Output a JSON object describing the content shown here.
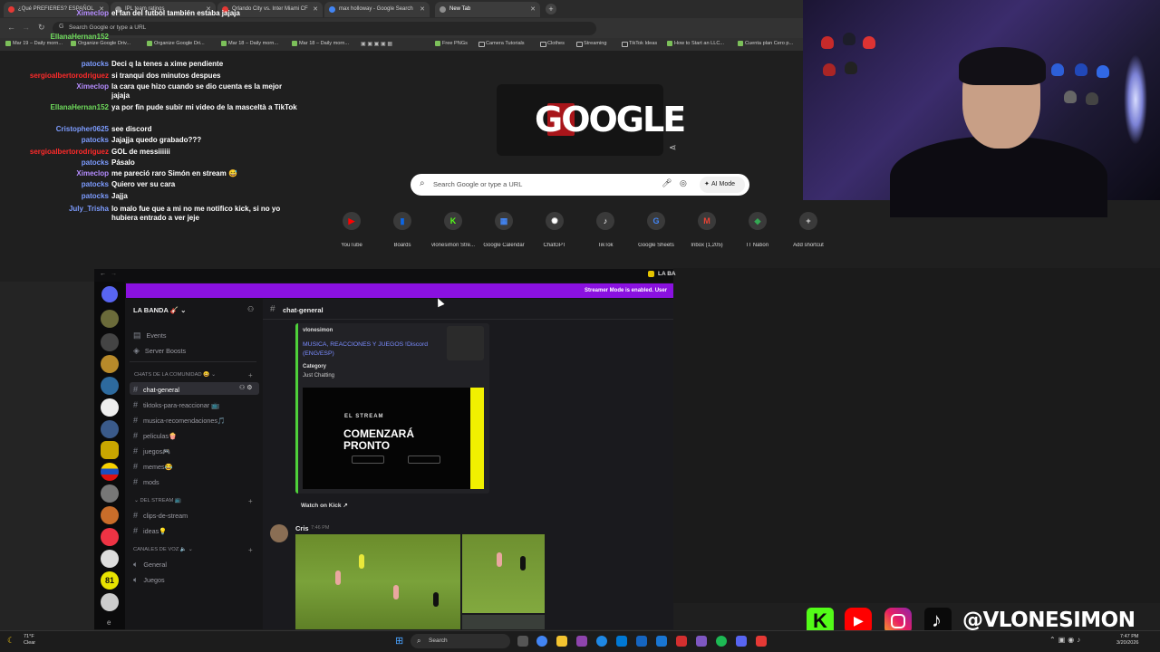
{
  "browser": {
    "tabs": [
      {
        "label": "¿Qué PREFIERES? ESPAÑOL",
        "color": "#e53935"
      },
      {
        "label": "IPL team ratings",
        "color": "#8e8e8e"
      },
      {
        "label": "Orlando City vs. Inter Miami CF",
        "color": "#e53935"
      },
      {
        "label": "max holloway - Google Search",
        "color": "#4285f4"
      },
      {
        "label": "New Tab",
        "color": "#8e8e8e"
      }
    ],
    "omnibox_placeholder": "Search Google or type a URL",
    "bookmarks": [
      "Mar 19 – Daily morn...",
      "Organize Google Driv...",
      "Organize Google Dri...",
      "Mar 18 – Daily morn...",
      "Mar 18 – Daily morn...",
      "Free PNGs",
      "Camera Tutorials",
      "Clothes",
      "Streaming",
      "TikTok Ideas",
      "How to Start an LLC...",
      "Cuenta plan Cero p..."
    ]
  },
  "ntp": {
    "doodle_text": "GOOGLE",
    "search_placeholder": "Search Google or type a URL",
    "ai_mode_label": "AI Mode",
    "shortcuts": [
      {
        "label": "YouTube",
        "glyph": "▶",
        "color": "#ff0000"
      },
      {
        "label": "Boards",
        "glyph": "▮",
        "color": "#0c66e4"
      },
      {
        "label": "vlonesimon Stre...",
        "glyph": "K",
        "color": "#53fc18"
      },
      {
        "label": "Google Calendar",
        "glyph": "▦",
        "color": "#4285f4"
      },
      {
        "label": "ChatGPT",
        "glyph": "✺",
        "color": "#ffffff"
      },
      {
        "label": "TikTok",
        "glyph": "♪",
        "color": "#ffffff"
      },
      {
        "label": "Google Sheets",
        "glyph": "G",
        "color": "#4285f4"
      },
      {
        "label": "Inbox (1,205)",
        "glyph": "M",
        "color": "#ea4335"
      },
      {
        "label": "IT Nation",
        "glyph": "◆",
        "color": "#34a853"
      },
      {
        "label": "Add shortcut",
        "glyph": "+",
        "color": "#dddddd"
      }
    ]
  },
  "chat": [
    {
      "user": "Ximeclop",
      "user_color": "#b58cff",
      "text": "el fan del futbol también estaba jajaja"
    },
    {
      "user": "EllanaHernan152",
      "user_color": "#6fdc5c",
      "text": ""
    },
    {
      "user": "patocks",
      "user_color": "#7d9cff",
      "text": "Deci q la tenes a xime pendiente"
    },
    {
      "user": "sergioalbertorodriguez",
      "user_color": "#ff2a2a",
      "text": "si tranqui dos minutos despues"
    },
    {
      "user": "Ximeclop",
      "user_color": "#b58cff",
      "text": "la cara que hizo cuando se dio cuenta es la mejor jajaja"
    },
    {
      "user": "EllanaHernan152",
      "user_color": "#6fdc5c",
      "text": "ya por fin pude subir mi video de la masceltà a TikTok"
    },
    {
      "user": "Cristopher0625",
      "user_color": "#7d9cff",
      "text": "see discord"
    },
    {
      "user": "patocks",
      "user_color": "#7d9cff",
      "text": "Jajajja quedo grabado???"
    },
    {
      "user": "sergioalbertorodriguez",
      "user_color": "#ff2a2a",
      "text": "GOL de messiiiiii"
    },
    {
      "user": "patocks",
      "user_color": "#7d9cff",
      "text": "Pásalo"
    },
    {
      "user": "Ximeclop",
      "user_color": "#b58cff",
      "text": "me pareció raro Simón en stream 😅"
    },
    {
      "user": "patocks",
      "user_color": "#7d9cff",
      "text": "Quiero ver su cara"
    },
    {
      "user": "patocks",
      "user_color": "#7d9cff",
      "text": "Jajja"
    },
    {
      "user": "July_Trisha",
      "user_color": "#7d9cff",
      "text": "lo malo fue que a mi no me notifico kick, si no yo hubiera entrado a ver jeje"
    }
  ],
  "discord": {
    "banner": "Streamer Mode is enabled. User",
    "topbar_right": "LA BA",
    "server_name": "LA BANDA 🎸",
    "channel_header": "chat-general",
    "nav": [
      "Events",
      "Server Boosts"
    ],
    "categories": {
      "community": "CHATS DE LA COMUNIDAD 😀",
      "stream": "DEL STREAM 📺",
      "voice": "CANALES DE VOZ 🔈"
    },
    "text_channels": [
      "chat-general",
      "tiktoks-para-reaccionar 📺",
      "musica-recomendaciones🎵",
      "peliculas🍿",
      "juegos🎮",
      "memes😂",
      "mods"
    ],
    "stream_channels": [
      "clips-de-stream",
      "ideas💡"
    ],
    "voice_channels": [
      "General",
      "Juegos"
    ],
    "embed": {
      "author": "vlonesimon",
      "title": "MUSICA, REACCIONES Y JUEGOS !Discord (ENG/ESP)",
      "field_name": "Category",
      "field_value": "Just Chatting",
      "video_small": "EL STREAM",
      "video_big1": "COMENZARÁ",
      "video_big2": "PRONTO",
      "link": "Watch on Kick"
    },
    "message": {
      "author": "Cris",
      "time": "7:46 PM"
    }
  },
  "socials": {
    "handle": "@VLONESIMON"
  },
  "taskbar": {
    "weather_temp": "71°F",
    "weather_desc": "Clear",
    "search": "Search",
    "time": "7:47 PM",
    "date": "3/20/2026"
  }
}
